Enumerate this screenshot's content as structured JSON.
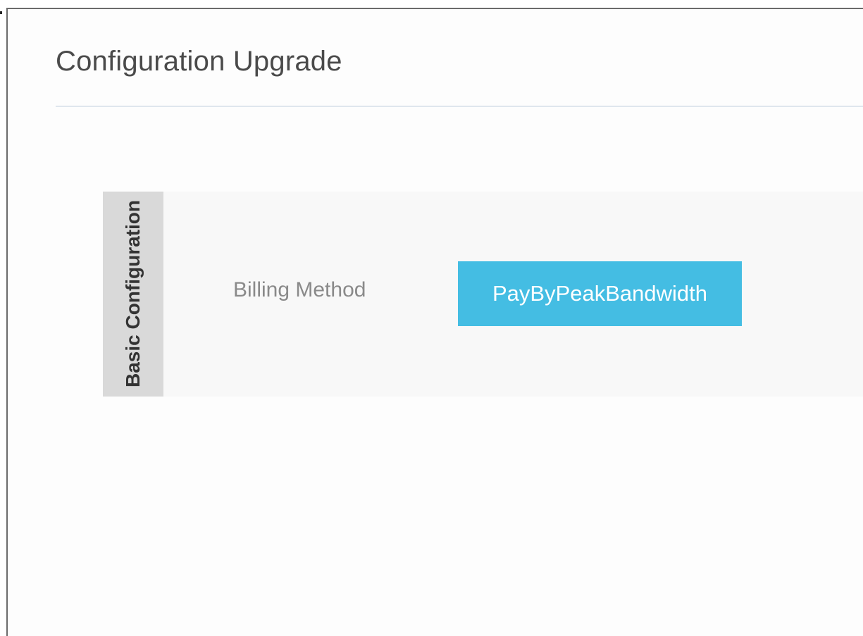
{
  "page": {
    "title": "Configuration Upgrade"
  },
  "section": {
    "label": "Basic Configuration"
  },
  "billing": {
    "label": "Billing Method",
    "selected": "PayByPeakBandwidth"
  },
  "colors": {
    "accent": "#44bde3",
    "section_tab": "#d9d9d9",
    "section_bg": "#f8f8f8",
    "divider": "#dfe6ee"
  }
}
